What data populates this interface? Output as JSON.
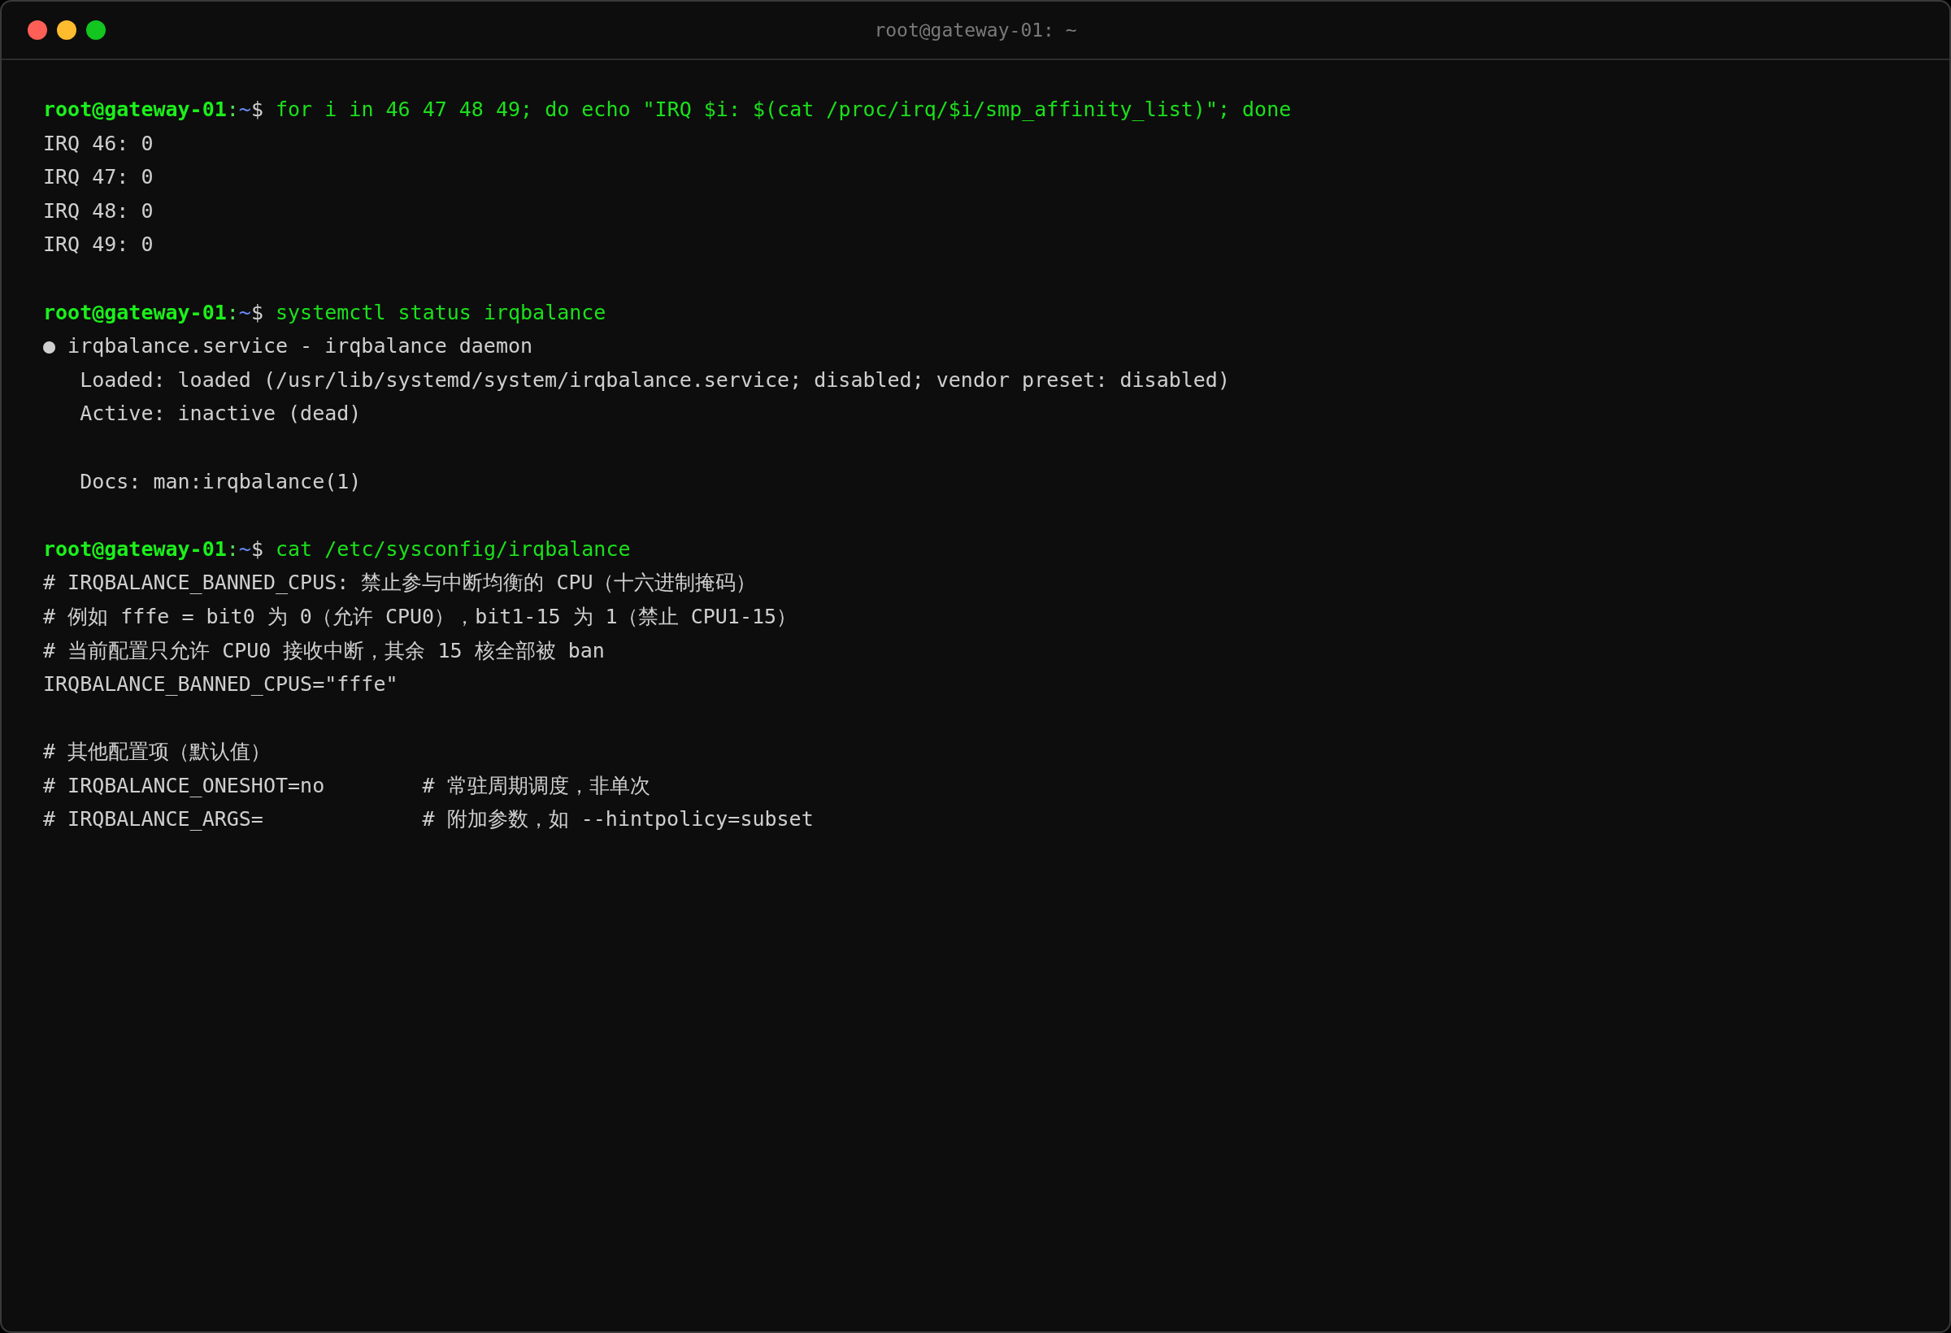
{
  "window": {
    "title": "root@gateway-01: ~"
  },
  "lines": [
    {
      "kind": "prompt",
      "user_host": "root@gateway-01",
      "separator": ":",
      "path": "~",
      "symbol": "$",
      "command": "for i in 46 47 48 49; do echo \"IRQ $i: $(cat /proc/irq/$i/smp_affinity_list)\"; done"
    },
    {
      "kind": "output",
      "text": "IRQ 46: 0"
    },
    {
      "kind": "output",
      "text": "IRQ 47: 0"
    },
    {
      "kind": "output",
      "text": "IRQ 48: 0"
    },
    {
      "kind": "output",
      "text": "IRQ 49: 0"
    },
    {
      "kind": "blank"
    },
    {
      "kind": "prompt",
      "user_host": "root@gateway-01",
      "separator": ":",
      "path": "~",
      "symbol": "$",
      "command": "systemctl status irqbalance"
    },
    {
      "kind": "output",
      "text": "● irqbalance.service - irqbalance daemon"
    },
    {
      "kind": "output",
      "text": "   Loaded: loaded (/usr/lib/systemd/system/irqbalance.service; disabled; vendor preset: disabled)"
    },
    {
      "kind": "output",
      "text": "   Active: inactive (dead)"
    },
    {
      "kind": "blank"
    },
    {
      "kind": "output",
      "text": "   Docs: man:irqbalance(1)"
    },
    {
      "kind": "blank"
    },
    {
      "kind": "prompt",
      "user_host": "root@gateway-01",
      "separator": ":",
      "path": "~",
      "symbol": "$",
      "command": "cat /etc/sysconfig/irqbalance"
    },
    {
      "kind": "output",
      "text": "# IRQBALANCE_BANNED_CPUS: 禁止参与中断均衡的 CPU（十六进制掩码）"
    },
    {
      "kind": "output",
      "text": "# 例如 fffe = bit0 为 0（允许 CPU0），bit1-15 为 1（禁止 CPU1-15）"
    },
    {
      "kind": "output",
      "text": "# 当前配置只允许 CPU0 接收中断，其余 15 核全部被 ban"
    },
    {
      "kind": "output",
      "text": "IRQBALANCE_BANNED_CPUS=\"fffe\""
    },
    {
      "kind": "blank"
    },
    {
      "kind": "output",
      "text": "# 其他配置项（默认值）"
    },
    {
      "kind": "output",
      "text": "# IRQBALANCE_ONESHOT=no        # 常驻周期调度，非单次"
    },
    {
      "kind": "output",
      "text": "# IRQBALANCE_ARGS=             # 附加参数，如 --hintpolicy=subset"
    }
  ]
}
